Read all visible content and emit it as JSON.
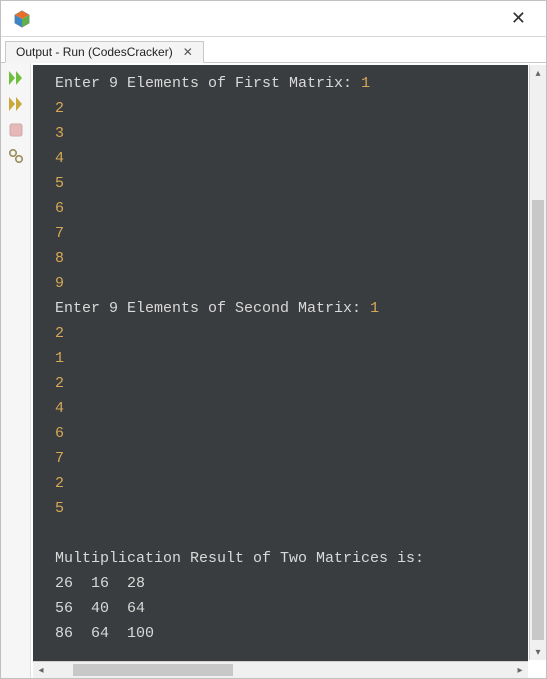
{
  "titlebar": {
    "close_glyph": "✕"
  },
  "tab": {
    "label": "Output - Run (CodesCracker)",
    "close_glyph": "✕"
  },
  "terminal": {
    "prompt1": "Enter 9 Elements of First Matrix: ",
    "prompt1_first": "1",
    "inputs1": [
      "2",
      "3",
      "4",
      "5",
      "6",
      "7",
      "8",
      "9"
    ],
    "prompt2": "Enter 9 Elements of Second Matrix: ",
    "prompt2_first": "1",
    "inputs2": [
      "2",
      "1",
      "2",
      "4",
      "6",
      "7",
      "2",
      "5"
    ],
    "result_header": "Multiplication Result of Two Matrices is:",
    "result_rows": [
      "26  16  28",
      "56  40  64",
      "86  64  100"
    ]
  }
}
